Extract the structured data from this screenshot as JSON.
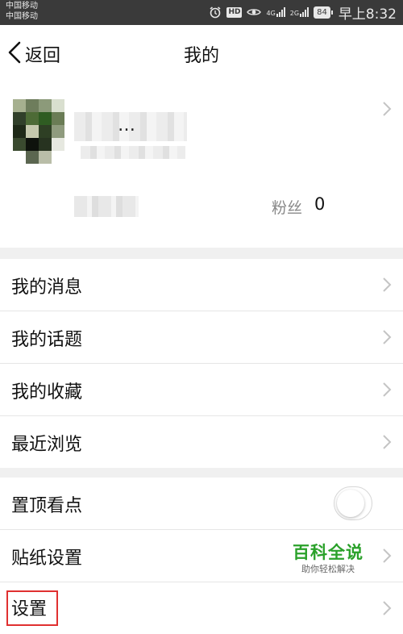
{
  "status_bar": {
    "carrier_1": "中国移动",
    "carrier_2": "中国移动",
    "network_1": "4G",
    "network_2": "2G",
    "battery": "84",
    "time": "早上8:32",
    "icons": [
      "alarm-icon",
      "hd-icon",
      "eye-icon",
      "signal-icon",
      "battery-icon"
    ]
  },
  "nav": {
    "back_label": "返回",
    "title": "我的"
  },
  "profile": {
    "name_suffix": "…",
    "fans_label": "粉丝",
    "fans_count": "0"
  },
  "menu_group_1": [
    {
      "label": "我的消息"
    },
    {
      "label": "我的话题"
    },
    {
      "label": "我的收藏"
    },
    {
      "label": "最近浏览"
    }
  ],
  "menu_group_2": {
    "pin_label": "置顶看点",
    "pin_toggle_on": false,
    "sticker_label": "贴纸设置",
    "settings_label": "设置"
  },
  "watermark": {
    "logo": "百科全说",
    "slogan": "助你轻松解决"
  },
  "colors": {
    "highlight_box": "#e03030",
    "watermark_green": "#2aa12a",
    "status_bar_bg": "#3a3a3a"
  }
}
